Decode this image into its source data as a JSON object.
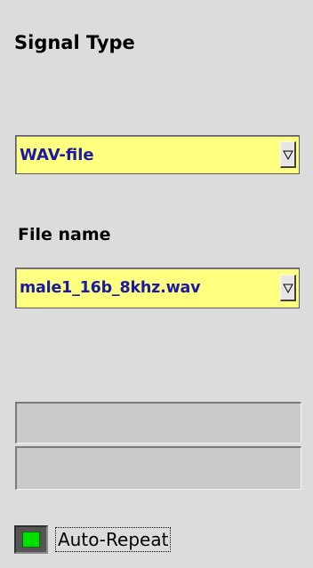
{
  "signal_type": {
    "heading": "Signal Type",
    "selected": "WAV-file",
    "arrow_icon": "triangle-down-icon"
  },
  "file_name": {
    "heading": "File name",
    "selected": "male1_16b_8khz.wav",
    "arrow_icon": "triangle-down-icon"
  },
  "fields": [
    {
      "value": ""
    },
    {
      "value": ""
    }
  ],
  "auto_repeat": {
    "label": "Auto-Repeat",
    "checked": true,
    "check_color": "#00e000"
  },
  "colors": {
    "background": "#dcdcdc",
    "dropdown_bg": "#ffff80",
    "dropdown_text": "#1a1aa6"
  }
}
